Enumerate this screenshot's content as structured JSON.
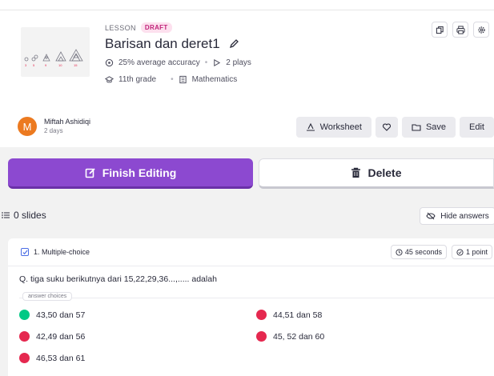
{
  "lesson": {
    "type_label": "LESSON",
    "status_badge": "DRAFT",
    "title": "Barisan dan deret1",
    "accuracy": "25% average accuracy",
    "plays": "2 plays",
    "grade": "11th grade",
    "subject": "Mathematics",
    "thumbnail_numbers": [
      "3",
      "5",
      "9",
      "10",
      "15"
    ]
  },
  "author": {
    "initial": "M",
    "name": "Miftah Ashidiqi",
    "time": "2 days"
  },
  "actions": {
    "worksheet": "Worksheet",
    "save": "Save",
    "edit": "Edit"
  },
  "main_buttons": {
    "finish": "Finish Editing",
    "delete": "Delete"
  },
  "slides": {
    "count_label": "0 slides",
    "hide_answers": "Hide answers"
  },
  "question": {
    "header": "1. Multiple-choice",
    "time": "45 seconds",
    "points": "1 point",
    "text": "Q. tiga suku berikutnya dari 15,22,29,36...,..... adalah",
    "answer_choices_label": "answer choices",
    "options": [
      {
        "text": "43,50 dan 57",
        "correct": true
      },
      {
        "text": "44,51 dan 58",
        "correct": false
      },
      {
        "text": "42,49 dan 56",
        "correct": false
      },
      {
        "text": "45, 52 dan 60",
        "correct": false
      },
      {
        "text": "46,53 dan 61",
        "correct": false
      }
    ]
  },
  "colors": {
    "accent_purple": "#8c49d0",
    "correct": "#00c985",
    "incorrect": "#e5284f",
    "draft": "#c0247a",
    "avatar": "#ec7a20"
  }
}
